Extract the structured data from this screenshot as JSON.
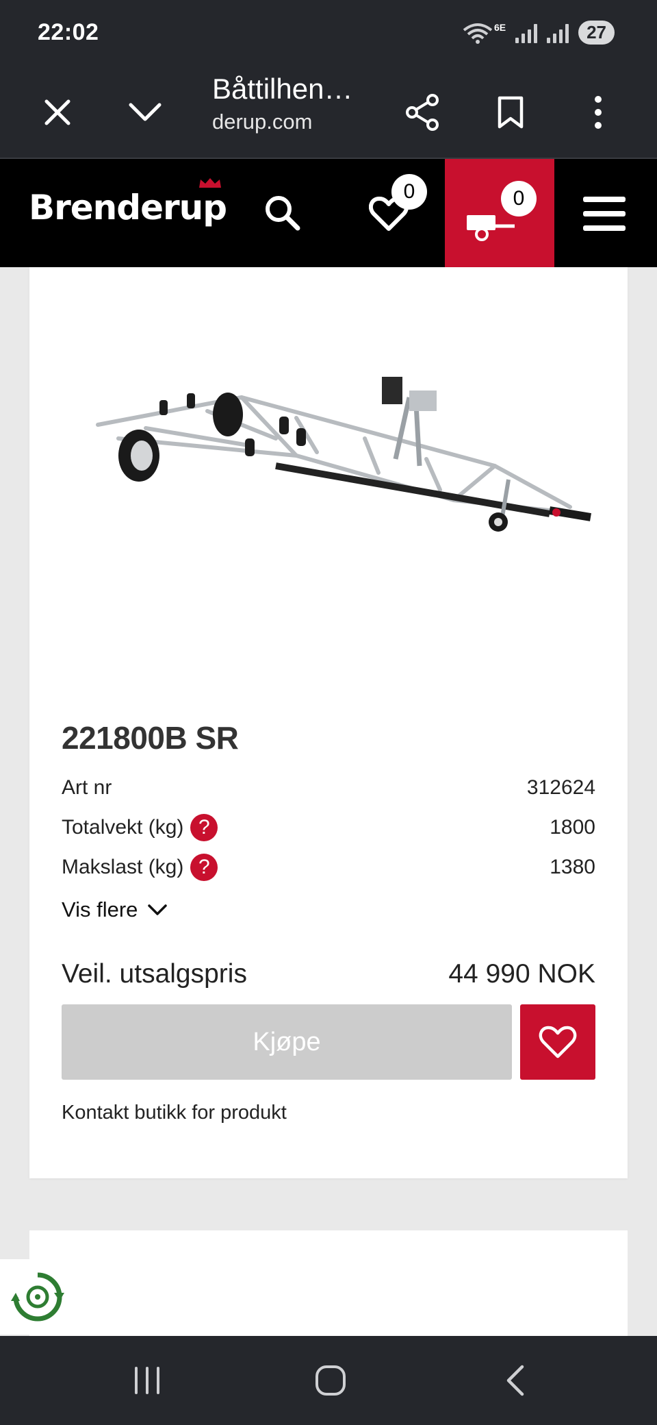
{
  "status_bar": {
    "time": "22:02",
    "network": "6E",
    "battery": "27"
  },
  "browser": {
    "title": "Båttilhen…",
    "url": "derup.com"
  },
  "site": {
    "logo": "Brenderup",
    "wishlist_count": "0",
    "cart_count": "0"
  },
  "product": {
    "title": "221800B SR",
    "specs": [
      {
        "label": "Art nr",
        "value": "312624"
      },
      {
        "label": "Totalvekt (kg)",
        "value": "1800"
      },
      {
        "label": "Makslast (kg)",
        "value": "1380"
      }
    ],
    "show_more": "Vis flere",
    "price_label": "Veil. utsalgspris",
    "price_value": "44 990 NOK",
    "buy_label": "Kjøpe",
    "contact_text": "Kontakt butikk for produkt"
  },
  "colors": {
    "brand_red": "#c8102e",
    "dark": "#25272c",
    "disabled": "#cccccc"
  }
}
